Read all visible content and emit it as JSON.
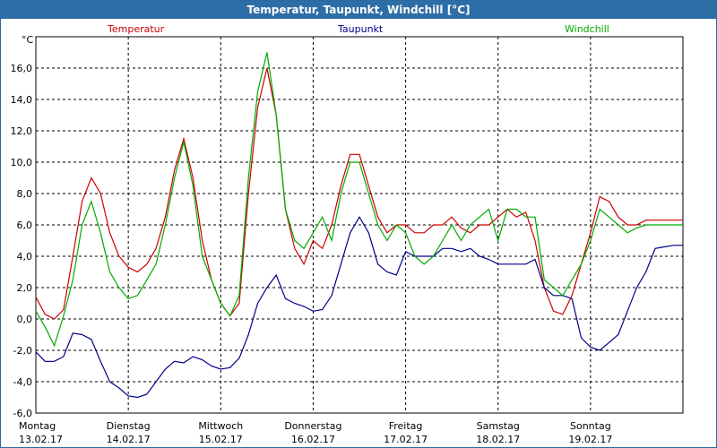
{
  "window": {
    "title": "Temperatur, Taupunkt, Windchill [°C]"
  },
  "chart_data": {
    "type": "line",
    "title": "Temperatur, Taupunkt, Windchill [°C]",
    "ylabel": "°C",
    "ylim": [
      -6,
      18
    ],
    "yticks": [
      "-6,0",
      "-4,0",
      "-2,0",
      "0,0",
      "2,0",
      "4,0",
      "6,0",
      "8,0",
      "10,0",
      "12,0",
      "14,0",
      "16,0"
    ],
    "xlim": [
      0,
      7
    ],
    "x_categories": [
      {
        "day": "Montag",
        "date": "13.02.17"
      },
      {
        "day": "Dienstag",
        "date": "14.02.17"
      },
      {
        "day": "Mittwoch",
        "date": "15.02.17"
      },
      {
        "day": "Donnerstag",
        "date": "16.02.17"
      },
      {
        "day": "Freitag",
        "date": "17.02.17"
      },
      {
        "day": "Samstag",
        "date": "18.02.17"
      },
      {
        "day": "Sonntag",
        "date": "19.02.17"
      }
    ],
    "grid": true,
    "series": [
      {
        "name": "Temperatur",
        "color": "#cc0000",
        "x": [
          0,
          0.1,
          0.2,
          0.3,
          0.4,
          0.5,
          0.6,
          0.7,
          0.8,
          0.9,
          1.0,
          1.1,
          1.2,
          1.3,
          1.4,
          1.5,
          1.6,
          1.7,
          1.8,
          1.9,
          2.0,
          2.1,
          2.2,
          2.3,
          2.4,
          2.5,
          2.6,
          2.7,
          2.8,
          2.9,
          3.0,
          3.1,
          3.2,
          3.3,
          3.4,
          3.5,
          3.6,
          3.7,
          3.8,
          3.9,
          4.0,
          4.1,
          4.2,
          4.3,
          4.4,
          4.5,
          4.6,
          4.7,
          4.8,
          4.9,
          5.0,
          5.1,
          5.2,
          5.3,
          5.4,
          5.5,
          5.6,
          5.7,
          5.8,
          5.9,
          6.0,
          6.1,
          6.2,
          6.3,
          6.4,
          6.5,
          6.6,
          6.7,
          6.8,
          6.9,
          7.0
        ],
        "y": [
          1.4,
          0.3,
          0.0,
          0.6,
          4.0,
          7.5,
          9.0,
          8.0,
          5.5,
          4.0,
          3.3,
          3.0,
          3.5,
          4.5,
          6.5,
          9.5,
          11.5,
          9.0,
          5.0,
          2.5,
          1.0,
          0.2,
          1.0,
          8.0,
          13.5,
          16.0,
          13.0,
          7.0,
          4.5,
          3.5,
          5.0,
          4.5,
          6.0,
          8.5,
          10.5,
          10.5,
          8.5,
          6.5,
          5.5,
          6.0,
          6.0,
          5.5,
          5.5,
          6.0,
          6.0,
          6.5,
          5.8,
          5.5,
          6.0,
          6.0,
          6.5,
          7.0,
          6.5,
          6.8,
          5.0,
          2.0,
          0.5,
          0.3,
          1.5,
          3.5,
          5.5,
          7.8,
          7.5,
          6.5,
          6.0,
          6.0,
          6.3,
          6.3,
          6.3,
          6.3,
          6.3
        ]
      },
      {
        "name": "Taupunkt",
        "color": "#00008b",
        "x": [
          0,
          0.1,
          0.2,
          0.3,
          0.4,
          0.5,
          0.6,
          0.7,
          0.8,
          0.9,
          1.0,
          1.1,
          1.2,
          1.3,
          1.4,
          1.5,
          1.6,
          1.7,
          1.8,
          1.9,
          2.0,
          2.1,
          2.2,
          2.3,
          2.4,
          2.5,
          2.6,
          2.7,
          2.8,
          2.9,
          3.0,
          3.1,
          3.2,
          3.3,
          3.4,
          3.5,
          3.6,
          3.7,
          3.8,
          3.9,
          4.0,
          4.1,
          4.2,
          4.3,
          4.4,
          4.5,
          4.6,
          4.7,
          4.8,
          4.9,
          5.0,
          5.1,
          5.2,
          5.3,
          5.4,
          5.5,
          5.6,
          5.7,
          5.8,
          5.9,
          6.0,
          6.1,
          6.2,
          6.3,
          6.4,
          6.5,
          6.6,
          6.7,
          6.8,
          6.9,
          7.0
        ],
        "y": [
          -2.1,
          -2.7,
          -2.7,
          -2.4,
          -0.9,
          -1.0,
          -1.3,
          -2.7,
          -4.0,
          -4.4,
          -4.9,
          -5.0,
          -4.8,
          -4.0,
          -3.2,
          -2.7,
          -2.8,
          -2.4,
          -2.6,
          -3.0,
          -3.2,
          -3.1,
          -2.5,
          -1.0,
          1.0,
          2.0,
          2.8,
          1.3,
          1.0,
          0.8,
          0.5,
          0.6,
          1.5,
          3.5,
          5.5,
          6.5,
          5.5,
          3.5,
          3.0,
          2.8,
          4.3,
          4.0,
          4.0,
          4.0,
          4.5,
          4.5,
          4.3,
          4.5,
          4.0,
          3.8,
          3.5,
          3.5,
          3.5,
          3.5,
          3.8,
          2.0,
          1.5,
          1.5,
          1.3,
          -1.2,
          -1.8,
          -2.0,
          -1.5,
          -1.0,
          0.5,
          2.0,
          3.0,
          4.5,
          4.6,
          4.7,
          4.7
        ]
      },
      {
        "name": "Windchill",
        "color": "#00aa00",
        "x": [
          0,
          0.1,
          0.2,
          0.3,
          0.4,
          0.5,
          0.6,
          0.7,
          0.8,
          0.9,
          1.0,
          1.1,
          1.2,
          1.3,
          1.4,
          1.5,
          1.6,
          1.7,
          1.8,
          1.9,
          2.0,
          2.1,
          2.2,
          2.3,
          2.4,
          2.5,
          2.6,
          2.7,
          2.8,
          2.9,
          3.0,
          3.1,
          3.2,
          3.3,
          3.4,
          3.5,
          3.6,
          3.7,
          3.8,
          3.9,
          4.0,
          4.1,
          4.2,
          4.3,
          4.4,
          4.5,
          4.6,
          4.7,
          4.8,
          4.9,
          5.0,
          5.1,
          5.2,
          5.3,
          5.4,
          5.5,
          5.6,
          5.7,
          5.8,
          5.9,
          6.0,
          6.1,
          6.2,
          6.3,
          6.4,
          6.5,
          6.6,
          6.7,
          6.8,
          6.9,
          7.0
        ],
        "y": [
          0.5,
          -0.5,
          -1.7,
          0.2,
          2.5,
          6.0,
          7.5,
          5.5,
          3.0,
          2.0,
          1.3,
          1.5,
          2.5,
          3.5,
          6.0,
          9.0,
          11.3,
          8.5,
          4.0,
          2.5,
          1.0,
          0.2,
          1.5,
          9.0,
          14.5,
          17.0,
          13.0,
          7.0,
          5.0,
          4.5,
          5.5,
          6.5,
          5.0,
          8.0,
          10.0,
          10.0,
          8.0,
          6.0,
          5.0,
          6.0,
          5.5,
          4.0,
          3.5,
          4.0,
          5.0,
          6.0,
          5.0,
          6.0,
          6.5,
          7.0,
          5.0,
          7.0,
          7.0,
          6.5,
          6.5,
          2.5,
          2.0,
          1.5,
          2.5,
          3.5,
          5.0,
          7.0,
          6.5,
          6.0,
          5.5,
          5.8,
          6.0,
          6.0,
          6.0,
          6.0,
          6.0
        ]
      }
    ]
  }
}
